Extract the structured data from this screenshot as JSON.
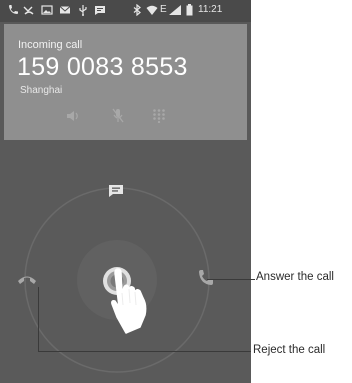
{
  "status_bar": {
    "time": "11:21",
    "network": "E",
    "icons": [
      "phone-icon",
      "missed-call-icon",
      "gallery-icon",
      "mail-icon",
      "usb-icon",
      "message-icon",
      "bluetooth-icon",
      "wifi-icon",
      "signal-icon",
      "battery-icon"
    ]
  },
  "call": {
    "status": "Incoming call",
    "number": "159 0083 8553",
    "location": "Shanghai",
    "controls": [
      "speaker-icon",
      "mute-icon",
      "dialpad-icon"
    ]
  },
  "actions": {
    "message_icon": "message-icon",
    "reject_icon": "reject-call-icon",
    "answer_icon": "answer-call-icon"
  },
  "annotations": {
    "answer": "Answer the call",
    "reject": "Reject the call"
  },
  "colors": {
    "phone_bg": "#595959",
    "card_bg": "#8f8f8f",
    "status_bg": "#4a4a4a",
    "text_light": "#f2f2f2",
    "annotation_line": "#3a3a3a"
  }
}
